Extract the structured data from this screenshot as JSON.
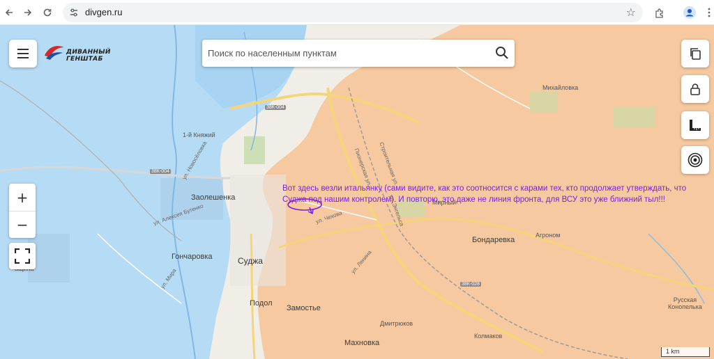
{
  "browser": {
    "url": "divgen.ru"
  },
  "map": {
    "search": {
      "placeholder": "Поиск по населенным пунктам"
    },
    "logo": {
      "text": "ДИВАННЫЙ ГЕНШТАБ"
    },
    "zoom": {
      "in_label": "+",
      "out_label": "−"
    },
    "scale_label": "1 km",
    "annotation": "Вот здесь везли итальянку (сами видите, как это соотносится с карами тех, кто продолжает утверждать, что Суджа под нашим контролем). И повторю, это даже не линия фронта, для ВСУ это уже ближний тыл!!!",
    "places": {
      "sudzha": "Суджа",
      "zaoleshenka": "Заолешенка",
      "goncharovka": "Гончаровка",
      "bondarevka": "Бондаревка",
      "agronom": "Агроном",
      "mikhaylovka": "Михайловка",
      "mirny": "Мирный",
      "podol": "Подол",
      "zamostye": "Замостье",
      "dmitryukov": "Дмитрюков",
      "makhnovka": "Махновка",
      "kolmakov": "Колмаков",
      "russkaya_konopelka": "Русская\nКонопелька",
      "knyazhiy": "1-й Княжий",
      "pshchina": "ащина"
    },
    "roads": {
      "r1": "38К-004",
      "r2": "38К-004",
      "r3": "38К-028"
    },
    "streets": {
      "novoselovka": "ул. Новосёловка",
      "butenko": "ул. Алексея Бутенко",
      "mira": "ул. Мира",
      "chekhova": "ул. Чехова",
      "lenina": "ул. Ленина",
      "pionerskaya": "Пионерская ул.",
      "stroitelnaya": "Строительная ул.",
      "engelsa": "ул. Энгельса"
    },
    "colors": {
      "occupied_zone": "#f6c9a0",
      "water": "#b6dcf5",
      "annotation": "#7a1fe0"
    }
  }
}
